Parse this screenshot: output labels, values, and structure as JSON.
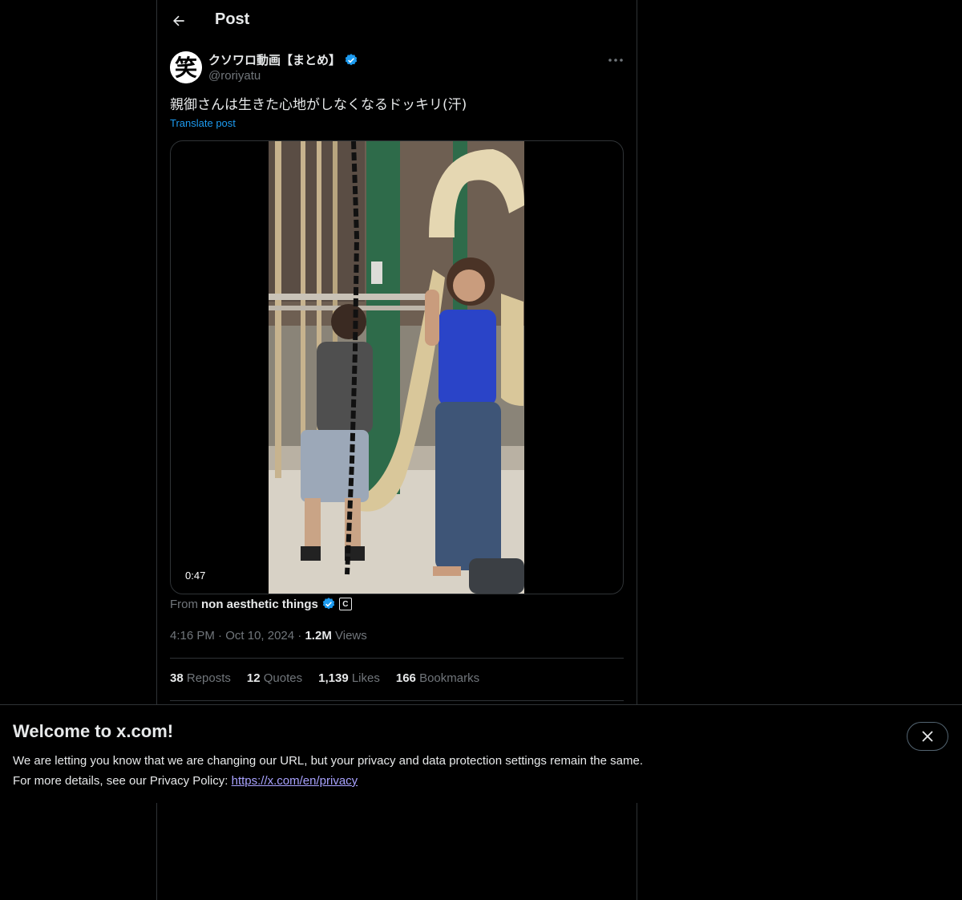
{
  "header": {
    "title": "Post"
  },
  "post": {
    "author_name": "クソワロ動画【まとめ】",
    "handle": "@roriyatu",
    "text": "親御さんは生きた心地がしなくなるドッキリ(汗)",
    "translate_label": "Translate post",
    "video_duration": "0:47",
    "source_prefix": "From",
    "source_name": "non aesthetic things",
    "source_badge": "C",
    "time": "4:16 PM",
    "date": "Oct 10, 2024",
    "separator": "·",
    "views_count": "1.2M",
    "views_label": "Views",
    "avatar_glyph": "笑"
  },
  "stats": {
    "reposts_count": "38",
    "reposts_label": "Reposts",
    "quotes_count": "12",
    "quotes_label": "Quotes",
    "likes_count": "1,139",
    "likes_label": "Likes",
    "bookmarks_count": "166",
    "bookmarks_label": "Bookmarks"
  },
  "banner": {
    "title": "Welcome to x.com!",
    "line1": "We are letting you know that we are changing our URL, but your privacy and data protection settings remain the same.",
    "line2_prefix": "For more details, see our Privacy Policy:",
    "link": "https://x.com/en/privacy"
  },
  "colors": {
    "background": "#000000",
    "accent": "#1d9bf0",
    "muted_text": "#71767b",
    "border": "#2f3336",
    "link": "#a9a3ff"
  },
  "icons": {
    "back": "arrow-left-icon",
    "verified": "verified-badge-icon",
    "more": "more-horizontal-icon",
    "close": "close-icon"
  }
}
